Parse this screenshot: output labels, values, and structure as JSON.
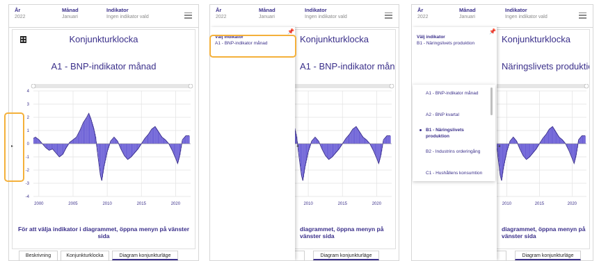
{
  "header": {
    "year_label": "År",
    "year_value": "2022",
    "month_label": "Månad",
    "month_value": "Januari",
    "indicator_label": "Indikator",
    "indicator_value": "Ingen indikator vald"
  },
  "chart_card": {
    "title": "Konjunkturklocka",
    "indicator_a1": "A1 - BNP-indikator månad",
    "indicator_b1": "Näringslivets produktion",
    "note": "För att välja indikator i diagrammet, öppna menyn på vänster sida",
    "note_partial": "diagrammet, öppna menyn på vänster sida"
  },
  "menu": {
    "label": "Välj indikator",
    "value_a1": "A1 - BNP-indikator månad",
    "value_b1": "B1 - Näringslivets produktion",
    "options": [
      {
        "label": "A1 - BNP-indikator månad",
        "selected": false
      },
      {
        "label": "A2 - BNP kvartal",
        "selected": false
      },
      {
        "label": "B1 - Näringslivets produktion",
        "selected": true
      },
      {
        "label": "B2 - Industrins orderingång",
        "selected": false
      },
      {
        "label": "C1 - Hushållens konsumtion",
        "selected": false
      }
    ]
  },
  "tabs": {
    "description": "Beskrivning",
    "clock": "Konjunkturklocka",
    "clock_partial": "locka",
    "diagram": "Diagram konjunkturläge"
  },
  "colors": {
    "accent": "#3a2f8a",
    "bars": "#6b5fd6",
    "highlight": "#f4b03a",
    "pin": "#5a7bd8"
  },
  "chart_data": {
    "type": "area",
    "x_ticks": [
      "2000",
      "2005",
      "2010",
      "2015",
      "2020"
    ],
    "y_ticks": [
      "4",
      "3",
      "2",
      "1",
      "0",
      "-1",
      "-2",
      "-3",
      "-4"
    ],
    "ylim": [
      -4,
      4
    ],
    "xlim": [
      1999.2,
      2022.2
    ],
    "grid": true,
    "series": [
      {
        "x": [
          1999.2,
          1999.5,
          2000,
          2000.5,
          2001,
          2001.5,
          2002,
          2002.5,
          2003,
          2003.5,
          2004,
          2004.5,
          2005,
          2005.5,
          2006,
          2006.5,
          2007,
          2007.3,
          2007.6,
          2008,
          2008.3,
          2008.6,
          2009,
          2009.2,
          2009.5,
          2010,
          2010.5,
          2011,
          2011.5,
          2012,
          2012.5,
          2013,
          2013.5,
          2014,
          2014.5,
          2015,
          2015.5,
          2016,
          2016.5,
          2017,
          2017.5,
          2018,
          2018.5,
          2019,
          2019.5,
          2020,
          2020.3,
          2020.6,
          2021,
          2021.5,
          2022
        ],
        "values": [
          0.4,
          0.5,
          0.3,
          0.0,
          -0.3,
          -0.5,
          -0.4,
          -0.7,
          -1.0,
          -0.8,
          -0.3,
          0.1,
          0.3,
          0.5,
          1.0,
          1.6,
          2.0,
          2.3,
          1.9,
          1.2,
          0.5,
          -0.8,
          -2.4,
          -2.8,
          -1.8,
          -0.6,
          0.2,
          0.5,
          0.2,
          -0.4,
          -0.9,
          -1.2,
          -1.0,
          -0.7,
          -0.4,
          0.0,
          0.4,
          0.7,
          1.1,
          1.3,
          0.9,
          0.5,
          0.3,
          0.0,
          -0.5,
          -1.1,
          -1.5,
          -0.9,
          0.3,
          0.6,
          0.6
        ]
      }
    ]
  }
}
